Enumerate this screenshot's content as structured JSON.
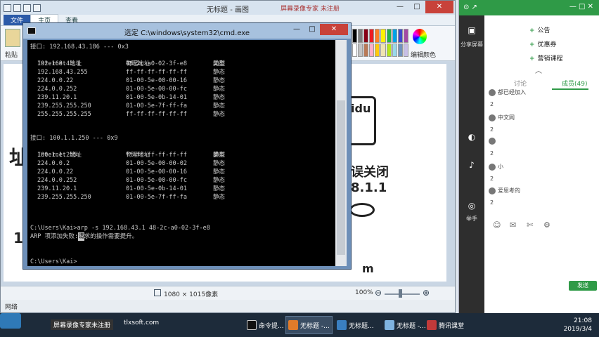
{
  "paint": {
    "title": "无标题 - 画图",
    "watermark": "屏幕录像专家 未注册",
    "tabs": [
      "文件",
      "主页",
      "查看"
    ],
    "paste_label": "粘贴",
    "edit_colors_label": "编辑颜色",
    "status_dims": "1080 × 1015像素",
    "zoom": "100%",
    "bottom_text": "网络",
    "bg_texts": {
      "logo": "idu",
      "left_glyph": "址",
      "left_num": "1",
      "error": "误关闭",
      "ip": "8.1.1",
      "m": "m"
    },
    "palette": [
      "#000000",
      "#7f7f7f",
      "#880015",
      "#ed1c24",
      "#ff7f27",
      "#fff200",
      "#22b14c",
      "#00a2e8",
      "#3f48cc",
      "#a349a4",
      "#ffffff",
      "#c3c3c3",
      "#b97a57",
      "#ffaec9",
      "#ffc90e",
      "#efe4b0",
      "#b5e61d",
      "#99d9ea",
      "#7092be",
      "#c8bfe7"
    ]
  },
  "cmd": {
    "title": "选定 C:\\windows\\system32\\cmd.exe",
    "buttons": [
      "—",
      "□",
      "✕"
    ],
    "block1_header": "接口: 192.168.43.186 --- 0x3",
    "block1_cols": [
      "Internet 地址",
      "物理地址",
      "类型"
    ],
    "block1_rows": [
      [
        "192.168.43.1",
        "48-2c-a0-02-3f-e8",
        "动态"
      ],
      [
        "192.168.43.255",
        "ff-ff-ff-ff-ff-ff",
        "静态"
      ],
      [
        "224.0.0.22",
        "01-00-5e-00-00-16",
        "静态"
      ],
      [
        "224.0.0.252",
        "01-00-5e-00-00-fc",
        "静态"
      ],
      [
        "239.11.20.1",
        "01-00-5e-0b-14-01",
        "静态"
      ],
      [
        "239.255.255.250",
        "01-00-5e-7f-ff-fa",
        "静态"
      ],
      [
        "255.255.255.255",
        "ff-ff-ff-ff-ff-ff",
        "静态"
      ]
    ],
    "block2_header": "接口: 100.1.1.250 --- 0x9",
    "block2_cols": [
      "Internet 地址",
      "物理地址",
      "类型"
    ],
    "block2_rows": [
      [
        "100.1.1.255",
        "ff-ff-ff-ff-ff-ff",
        "静态"
      ],
      [
        "224.0.0.2",
        "01-00-5e-00-00-02",
        "静态"
      ],
      [
        "224.0.0.22",
        "01-00-5e-00-00-16",
        "静态"
      ],
      [
        "224.0.0.252",
        "01-00-5e-00-00-fc",
        "静态"
      ],
      [
        "239.11.20.1",
        "01-00-5e-0b-14-01",
        "静态"
      ],
      [
        "239.255.255.250",
        "01-00-5e-7f-ff-fa",
        "静态"
      ]
    ],
    "command": "C:\\Users\\Kai>arp -s 192.168.43.1 48-2c-a0-02-3f-e8",
    "error_pre": "ARP 项添加失败:",
    "error_sel": "请",
    "error_post": "求的操作需要提升。",
    "prompt": "C:\\Users\\Kai>"
  },
  "chat": {
    "top_left": "⊙ ↗",
    "top_right": "— □ ✕",
    "side": [
      {
        "icon": "▣",
        "label": "分享屏幕"
      },
      {
        "icon": "◐",
        "label": ""
      },
      {
        "icon": "♪",
        "label": ""
      },
      {
        "icon": "◎",
        "label": "举手"
      }
    ],
    "menu": [
      "公告",
      "优惠券",
      "营销课程"
    ],
    "tab_discuss": "讨论",
    "tab_members": "成员(49)",
    "members": [
      "都已经加入",
      "中文网",
      "",
      "小",
      "爱思考的"
    ],
    "member_nums": [
      "2",
      "2",
      "2",
      "2",
      "2"
    ],
    "input_icons": [
      "☺",
      "✉",
      "✄",
      "⚙"
    ],
    "send": "发送"
  },
  "taskbar": {
    "banner": "屏幕录像专家未注册",
    "banner2": "tlxsoft.com",
    "items": [
      {
        "label": "命令提...",
        "color": "#111111"
      },
      {
        "label": "无标题 -...",
        "color": "#e07b2a"
      },
      {
        "label": "无标题...",
        "color": "#3a7fc1"
      },
      {
        "label": "无标题 -...",
        "color": "#7fb3e0"
      },
      {
        "label": "腾讯课堂",
        "color": "#c23a3a"
      }
    ],
    "time": "21:08",
    "date": "2019/3/4"
  }
}
